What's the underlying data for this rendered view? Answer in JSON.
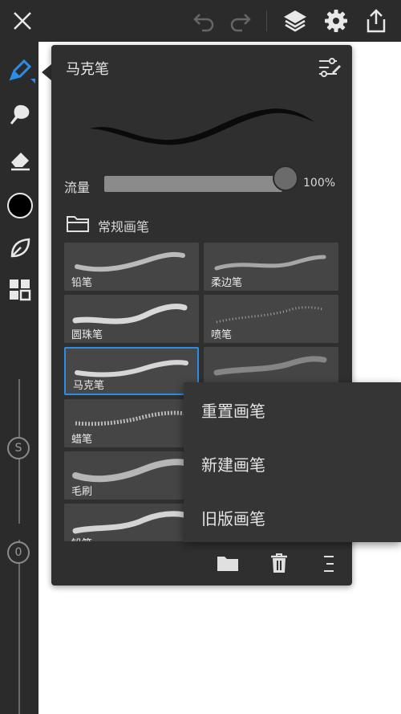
{
  "topbar": {
    "icons": [
      "close-icon",
      "undo-icon",
      "redo-icon",
      "layers-icon",
      "gear-icon",
      "share-icon"
    ]
  },
  "leftbar": {
    "tools": [
      "brush-tool-icon",
      "smudge-tool-icon",
      "eraser-tool-icon",
      "color-swatch",
      "leaf-icon",
      "grid-icon"
    ],
    "size_slider_label": "S",
    "opacity_slider_label": "0",
    "accent": "#2b8de6"
  },
  "brush_panel": {
    "title": "马克笔",
    "flow_label": "流量",
    "flow_value": "100%",
    "flow_fraction": 1.0,
    "section_label": "常规画笔",
    "brushes": [
      {
        "label": "铅笔"
      },
      {
        "label": "柔边笔"
      },
      {
        "label": "圆珠笔"
      },
      {
        "label": "喷笔"
      },
      {
        "label": "马克笔",
        "selected": true
      },
      {
        "label": ""
      },
      {
        "label": "蜡笔"
      },
      {
        "label": ""
      },
      {
        "label": "毛刷"
      },
      {
        "label": ""
      },
      {
        "label": "铅笔"
      },
      {
        "label": ""
      }
    ],
    "footer_icons": [
      "folder-icon",
      "trash-icon",
      "menu-icon"
    ]
  },
  "context_menu": {
    "items": [
      "重置画笔",
      "新建画笔",
      "旧版画笔"
    ]
  }
}
